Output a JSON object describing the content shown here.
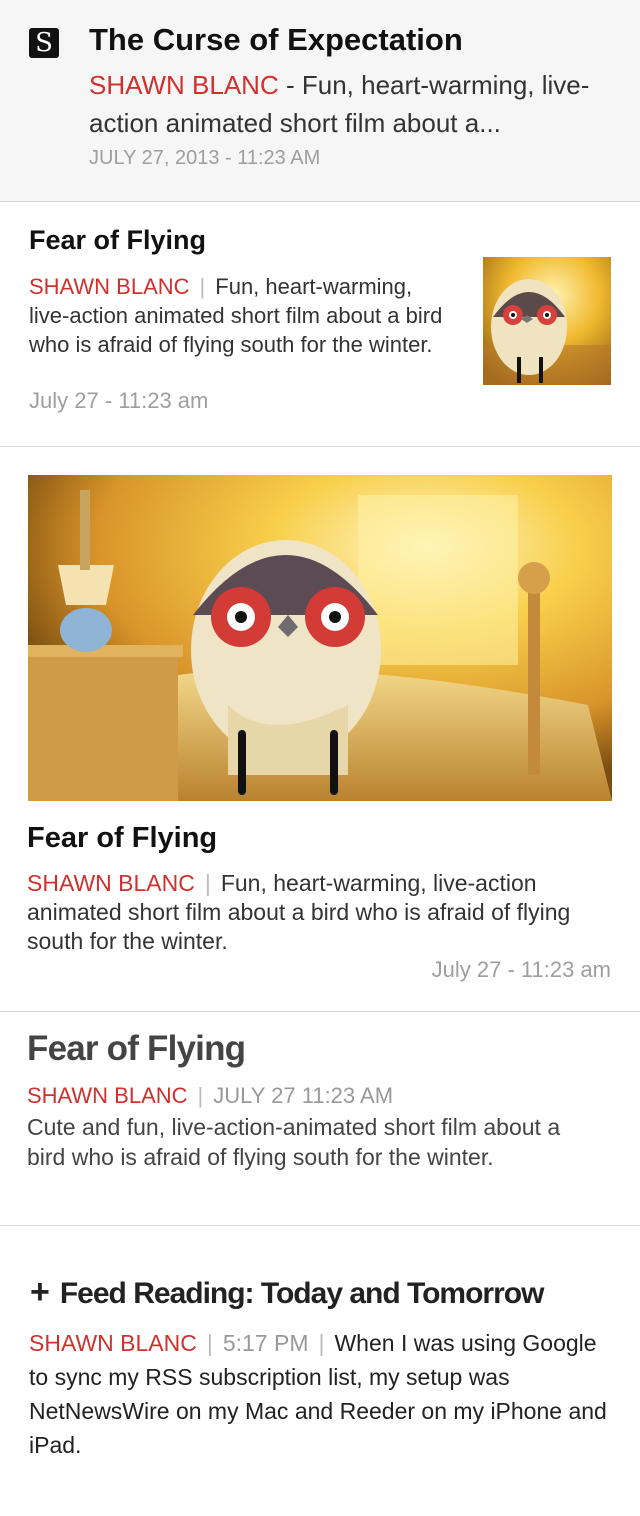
{
  "items": [
    {
      "badge": "S",
      "title": "The Curse of Expectation",
      "author": "SHAWN BLANC",
      "separator": "-",
      "summary": "Fun, heart-warming, live-action animated short film about a...",
      "date": "JULY 27, 2013 - 11:23 AM"
    },
    {
      "title": "Fear of Flying",
      "author": "SHAWN BLANC",
      "separator": "|",
      "summary": "Fun, heart-warming, live-action animated short film about a bird who is afraid of flying south for the winter.",
      "date": "July 27 - 11:23 am",
      "thumbnail": "bird-in-bedroom-thumbnail"
    },
    {
      "title": "Fear of Flying",
      "author": "SHAWN BLANC",
      "separator": "|",
      "summary": "Fun, heart-warming, live-action animated short film about a bird who is afraid of flying south for the winter.",
      "date": "July 27 - 11:23 am",
      "image": "bird-in-bedroom-hero-image"
    },
    {
      "title": "Fear of Flying",
      "author": "SHAWN BLANC",
      "separator": "|",
      "date": "JULY 27 11:23 AM",
      "summary": "Cute and fun, live-action-animated short film about a bird who is afraid of flying south for the winter."
    },
    {
      "icon": "plus-icon",
      "title": "Feed Reading: Today and Tomorrow",
      "author": "SHAWN BLANC",
      "separator": "|",
      "time": "5:17 PM",
      "summary": "When I was using Google to sync my RSS subscription list, my setup was NetNewsWire on my Mac and Reeder on my iPhone and iPad."
    }
  ],
  "colors": {
    "accent": "#d0312d",
    "meta_gray": "#9e9e9e",
    "divider": "#d4d4d4",
    "first_card_bg": "#f6f6f6"
  }
}
